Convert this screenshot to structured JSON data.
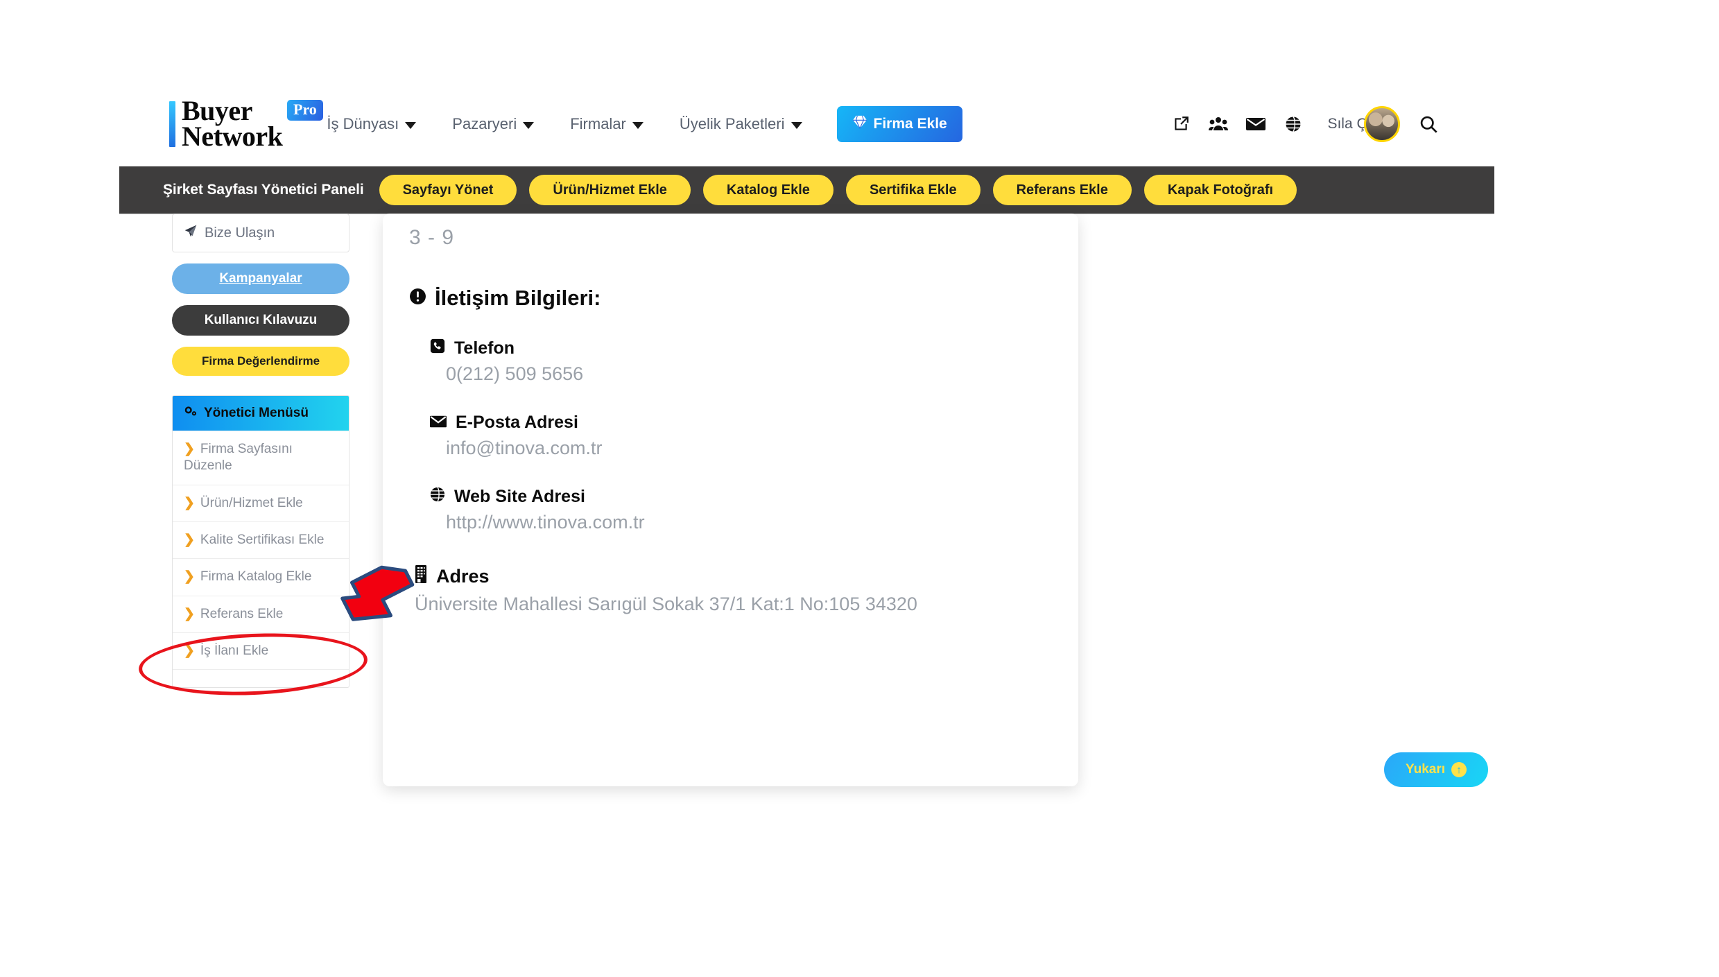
{
  "brand": {
    "logo_line1": "Buyer",
    "logo_line2": "Network",
    "logo_badge": "Pro"
  },
  "header": {
    "nav": [
      {
        "label": "İş Dünyası",
        "has_caret": true
      },
      {
        "label": "Pazaryeri",
        "has_caret": true
      },
      {
        "label": "Firmalar",
        "has_caret": true
      },
      {
        "label": "Üyelik Paketleri",
        "has_caret": true
      }
    ],
    "cta_label": "Firma Ekle",
    "cta_icon": "diamond-icon",
    "icons": [
      {
        "name": "external-link-icon"
      },
      {
        "name": "users-group-icon"
      },
      {
        "name": "envelope-icon"
      },
      {
        "name": "globe-icon"
      }
    ],
    "username": "Sıla Çil",
    "avatar_name": "user-avatar",
    "search_icon": "search-icon"
  },
  "admin_bar": {
    "title": "Şirket Sayfası Yönetici Paneli",
    "buttons": [
      "Sayfayı Yönet",
      "Ürün/Hizmet Ekle",
      "Katalog Ekle",
      "Sertifika Ekle",
      "Referans Ekle",
      "Kapak Fotoğrafı"
    ]
  },
  "sidebar": {
    "contact_card": {
      "icon": "paper-plane-icon",
      "label": "Bize Ulaşın"
    },
    "buttons": [
      {
        "label": "Kampanyalar",
        "style": "blue"
      },
      {
        "label": "Kullanıcı Kılavuzu",
        "style": "dark"
      },
      {
        "label": "Firma Değerlendirme",
        "style": "yellow"
      }
    ],
    "menu": {
      "header_icon": "gears-icon",
      "header_label": "Yönetici Menüsü",
      "items": [
        {
          "label": "Firma Sayfasını Düzenle"
        },
        {
          "label": "Ürün/Hizmet Ekle"
        },
        {
          "label": "Kalite Sertifikası Ekle"
        },
        {
          "label": "Firma Katalog Ekle",
          "highlighted": true
        },
        {
          "label": "Referans Ekle"
        },
        {
          "label": "İş İlanı Ekle"
        }
      ],
      "chevron_icon": "chevron-right-icon"
    }
  },
  "content": {
    "hours": "3 - 9",
    "section_icon": "info-circle-icon",
    "section_title": "İletişim Bilgileri:",
    "fields": [
      {
        "icon": "phone-icon",
        "label": "Telefon",
        "value": "0(212) 509 5656"
      },
      {
        "icon": "envelope-icon",
        "label": "E-Posta Adresi",
        "value": "info@tinova.com.tr"
      },
      {
        "icon": "globe-icon",
        "label": "Web Site Adresi",
        "value": "http://www.tinova.com.tr"
      }
    ],
    "address": {
      "icon": "building-icon",
      "label": "Adres",
      "value": "Üniversite Mahallesi Sarıgül Sokak 37/1 Kat:1 No:105 34320"
    }
  },
  "back_to_top": {
    "label": "Yukarı",
    "icon": "arrow-up-circle-icon"
  },
  "annotations": {
    "arrow": {
      "name": "red-pointer-arrow",
      "color": "#f20010",
      "outline": "#2b4b7e"
    },
    "ellipse": {
      "name": "red-highlight-ellipse",
      "color": "#e8141c",
      "targets": "Firma Katalog Ekle"
    }
  },
  "colors": {
    "brand_yellow": "#ffdd3c",
    "admin_bar_dark": "#3e3d3d",
    "accent_blue": "#1f8ef1",
    "annotation_red": "#e8141c"
  }
}
